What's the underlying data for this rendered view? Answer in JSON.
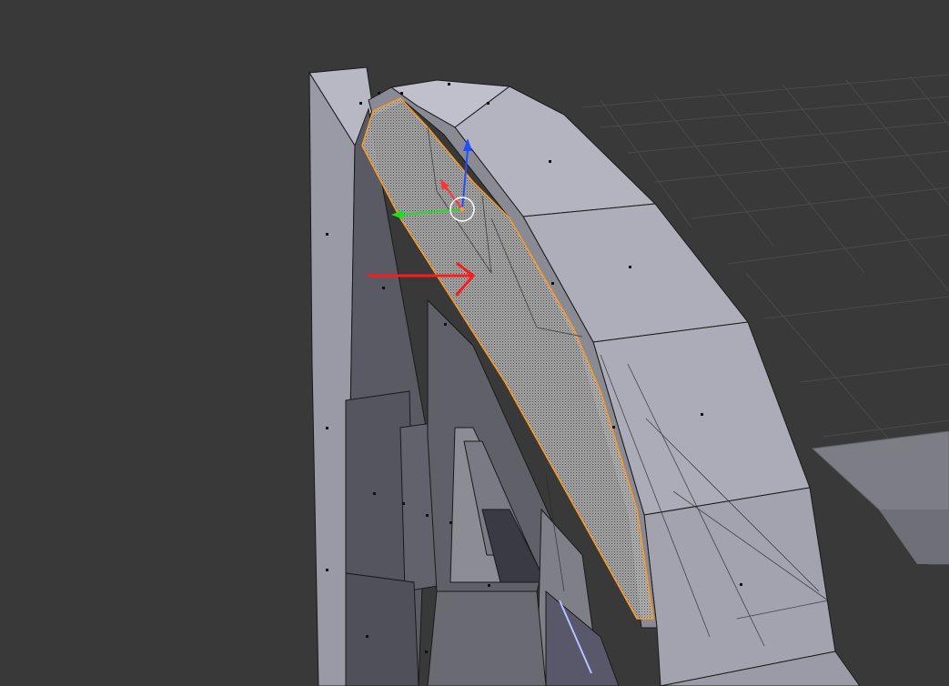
{
  "app": {
    "viewport": "3d-viewport",
    "mode": "edit-mode",
    "selection": "face",
    "annotation": "red-arrow"
  },
  "gizmo": {
    "axes": [
      {
        "axis": "z",
        "color": "#1f4fff"
      },
      {
        "axis": "y",
        "color": "#22dd22"
      },
      {
        "axis": "x",
        "color": "#ff3333"
      }
    ],
    "pivot_color": "#ff9933"
  },
  "colors": {
    "background": "#393939",
    "grid": "#4a4a4a",
    "mesh_light": "#b2b2bf",
    "mesh_mid": "#8c8c96",
    "mesh_dark": "#565660",
    "wire": "#1a1a1a",
    "selected_edge": "#ff9a1f",
    "annotation_arrow": "#ff1a1a"
  }
}
